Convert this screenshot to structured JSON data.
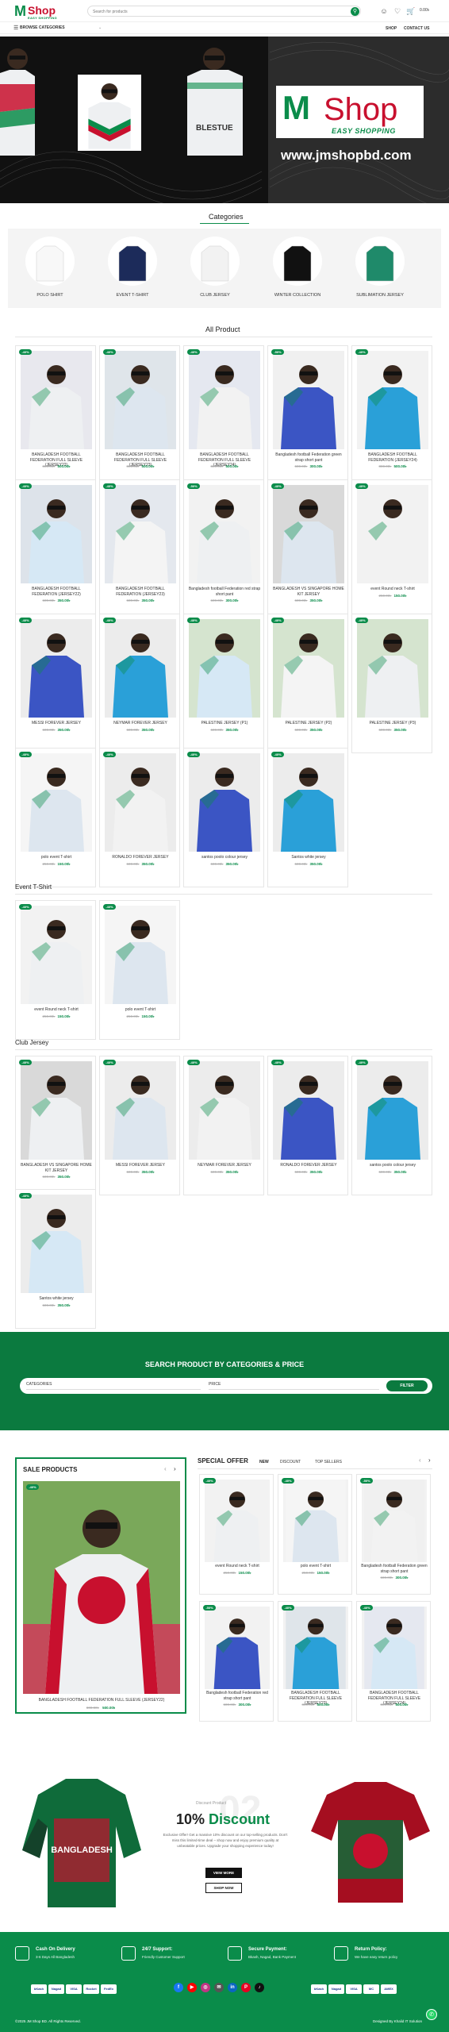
{
  "header": {
    "logo_m": "M",
    "logo_shop": "Shop",
    "logo_tag": "EASY SHOPPING",
    "search_placeholder": "Search for products",
    "cart_amount": "0.00৳"
  },
  "nav": {
    "browse": "BROWSE CATEGORIES",
    "links": [
      "SHOP",
      "CONTACT US"
    ]
  },
  "hero": {
    "brand_m": "M",
    "brand_shop": "Shop",
    "brand_tag": "EASY SHOPPING",
    "url": "www.jmshopbd.com",
    "jersey_text": "BLESTUE"
  },
  "categories": {
    "title": "Categories",
    "items": [
      "POLO SHIRT",
      "EVENT T-SHIRT",
      "CLUB JERSEY",
      "WINTER COLLECTION",
      "SUBLIMATION JERSEY"
    ]
  },
  "all_products": {
    "title": "All Product",
    "items": [
      {
        "badge": "-40%",
        "name": "BANGLADESH FOOTBALL FEDERATION FULL SLEEVE (JERSEY22)",
        "old": "800.00৳",
        "new": "500.00৳",
        "color": "#e8e8ee"
      },
      {
        "badge": "-40%",
        "name": "BANGLADESH FOOTBALL FEDERATION FULL SLEEVE (JERSEY23)",
        "old": "800.00৳",
        "new": "500.00৳",
        "color": "#dfe5ea"
      },
      {
        "badge": "-40%",
        "name": "BANGLADESH FOOTBALL FEDERATION FULL SLEEVE (JERSEY24)",
        "old": "800.00৳",
        "new": "500.00৳",
        "color": "#e5e8f0"
      },
      {
        "badge": "-50%",
        "name": "Bangladesh football Federation green strap short pant",
        "old": "600.00৳",
        "new": "300.00৳",
        "color": "#f0f0f0"
      },
      {
        "badge": "-40%",
        "name": "BANGLADESH FOOTBALL FEDERATION (JERSEY24)",
        "old": "800.00৳",
        "new": "500.00৳",
        "color": "#f2f2f2"
      },
      {
        "badge": "-40%",
        "name": "BANGLADESH FOOTBALL FEDERATION (JERSEY22)",
        "old": "600.00৳",
        "new": "350.00৳",
        "color": "#dde3ea"
      },
      {
        "badge": "-40%",
        "name": "BANGLADESH FOOTBALL FEDERATION (JERSEY23)",
        "old": "600.00৳",
        "new": "350.00৳",
        "color": "#e4e8ee"
      },
      {
        "badge": "-50%",
        "name": "Bangladesh football Federation red strap short pant",
        "old": "600.00৳",
        "new": "300.00৳",
        "color": "#f2f2f2"
      },
      {
        "badge": "-40%",
        "name": "BANGLADESH VS SINGAPORE HOME KIT JERSEY",
        "old": "600.00৳",
        "new": "350.00৳",
        "color": "#d9d9d9"
      },
      {
        "badge": "-40%",
        "name": "event Round neck T-shirt",
        "old": "250.00৳",
        "new": "150.00৳",
        "color": "#f2f2f2"
      },
      {
        "badge": "-40%",
        "name": "MESSI FOREVER JERSEY",
        "old": "600.00৳",
        "new": "350.00৳",
        "color": "#ececec"
      },
      {
        "badge": "-40%",
        "name": "NEYMAR FOREVER JERSEY",
        "old": "600.00৳",
        "new": "350.00৳",
        "color": "#ececec"
      },
      {
        "badge": "-40%",
        "name": "PALESTINE JERSEY (P1)",
        "old": "600.00৳",
        "new": "350.00৳",
        "color": "#d5e4cf"
      },
      {
        "badge": "-40%",
        "name": "PALESTINE JERSEY (P2)",
        "old": "600.00৳",
        "new": "350.00৳",
        "color": "#d5e4cf"
      },
      {
        "badge": "-40%",
        "name": "PALESTINE JERSEY (P3)",
        "old": "600.00৳",
        "new": "350.00৳",
        "color": "#d5e4cf"
      },
      {
        "badge": "-40%",
        "name": "polo event T-shirt",
        "old": "250.00৳",
        "new": "150.00৳",
        "color": "#f5f5f5"
      },
      {
        "badge": "-40%",
        "name": "RONALDO FOREVER JERSEY",
        "old": "600.00৳",
        "new": "350.00৳",
        "color": "#ececec"
      },
      {
        "badge": "-40%",
        "name": "santos poolo colour jersey",
        "old": "600.00৳",
        "new": "350.00৳",
        "color": "#ececec"
      },
      {
        "badge": "-40%",
        "name": "Santos white jersey",
        "old": "600.00৳",
        "new": "350.00৳",
        "color": "#ececec"
      }
    ]
  },
  "event_tshirt": {
    "title": "Event T-Shirt",
    "items": [
      {
        "badge": "-40%",
        "name": "event Round neck T-shirt",
        "old": "250.00৳",
        "new": "150.00৳",
        "color": "#f2f2f2"
      },
      {
        "badge": "-40%",
        "name": "polo event T-shirt",
        "old": "250.00৳",
        "new": "150.00৳",
        "color": "#f5f5f5"
      }
    ]
  },
  "club_jersey": {
    "title": "Club Jersey",
    "items": [
      {
        "badge": "-40%",
        "name": "BANGLADESH VS SINGAPORE HOME KIT JERSEY",
        "old": "600.00৳",
        "new": "350.00৳",
        "color": "#d9d9d9"
      },
      {
        "badge": "-40%",
        "name": "MESSI FOREVER JERSEY",
        "old": "600.00৳",
        "new": "350.00৳",
        "color": "#ececec"
      },
      {
        "badge": "-40%",
        "name": "NEYMAR FOREVER JERSEY",
        "old": "600.00৳",
        "new": "350.00৳",
        "color": "#ececec"
      },
      {
        "badge": "-40%",
        "name": "RONALDO FOREVER JERSEY",
        "old": "600.00৳",
        "new": "350.00৳",
        "color": "#ececec"
      },
      {
        "badge": "-40%",
        "name": "santos poolo colour jersey",
        "old": "600.00৳",
        "new": "350.00৳",
        "color": "#ececec"
      },
      {
        "badge": "-40%",
        "name": "Santos white jersey",
        "old": "600.00৳",
        "new": "350.00৳",
        "color": "#ececec"
      }
    ]
  },
  "search_band": {
    "title": "SEARCH PRODUCT BY CATEGORIES & PRICE",
    "categories_label": "CATEGORIES",
    "price_label": "PRICE",
    "filter_label": "FILTER"
  },
  "sale_products": {
    "title": "SALE PRODUCTS",
    "badge": "-40%",
    "name": "BANGLADESH FOOTBALL FEDERATION FULL SLEEVE (JERSEY22)",
    "old": "800.00৳",
    "new": "500.00৳"
  },
  "special_offer": {
    "title": "SPECIAL OFFER",
    "tabs": [
      "NEW",
      "DISCOUNT",
      "TOP SELLERS"
    ],
    "items": [
      {
        "badge": "-40%",
        "name": "event Round neck T-shirt",
        "old": "250.00৳",
        "new": "150.00৳",
        "color": "#f2f2f2"
      },
      {
        "badge": "-40%",
        "name": "polo event T-shirt",
        "old": "250.00৳",
        "new": "150.00৳",
        "color": "#f5f5f5"
      },
      {
        "badge": "-50%",
        "name": "Bangladesh football Federation green strap short pant",
        "old": "600.00৳",
        "new": "300.00৳",
        "color": "#f0f0f0"
      },
      {
        "badge": "-50%",
        "name": "Bangladesh football Federation red strap short pant",
        "old": "600.00৳",
        "new": "300.00৳",
        "color": "#f2f2f2"
      },
      {
        "badge": "-40%",
        "name": "BANGLADESH FOOTBALL FEDERATION FULL SLEEVE (JERSEY23)",
        "old": "800.00৳",
        "new": "500.00৳",
        "color": "#dfe5ea"
      },
      {
        "badge": "-40%",
        "name": "BANGLADESH FOOTBALL FEDERATION FULL SLEEVE (JERSEY24)",
        "old": "800.00৳",
        "new": "500.00৳",
        "color": "#e5e8f0"
      }
    ]
  },
  "promo": {
    "small": "Discount Product",
    "big_num": "02",
    "headline_a": "10%",
    "headline_b": "Discount",
    "body": "Exclusive Offer! Get a massive 10% discount on our top-selling products. Don't miss this limited-time deal – shop now and enjoy premium quality at unbeatable prices. Upgrade your shopping experience today!",
    "btn1": "VIEW MORE",
    "btn2": "SHOP NOW",
    "jersey_text": "BANGLADESH"
  },
  "features": [
    {
      "title": "Cash On Delivery",
      "sub": "3-6 Days All Bangladesh"
    },
    {
      "title": "24/7 Support:",
      "sub": "Friendly Customer Support"
    },
    {
      "title": "Secure Payment:",
      "sub": "Bkash, Nagad, Bank Payment"
    },
    {
      "title": "Return Policy:",
      "sub": "We have easy return policy"
    }
  ],
  "payments_left": [
    "bKash",
    "Nagad",
    "VISA",
    "Rocket",
    "FedEx"
  ],
  "payments_right": [
    "bKash",
    "Nagad",
    "VISA",
    "MC",
    "AMEX"
  ],
  "footer": {
    "copy": "©2025 JM Shop BD. All Rights Reserved.",
    "credit": "Designed By Khalid IT Solution"
  },
  "colors": {
    "brand_green": "#0a8c4a",
    "brand_red": "#c8102e"
  }
}
